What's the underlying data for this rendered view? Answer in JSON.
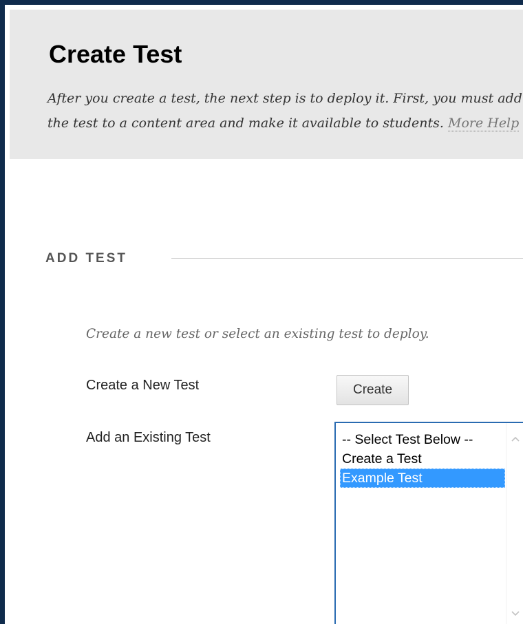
{
  "header": {
    "title": "Create Test",
    "description": "After you create a test, the next step is to deploy it. First, you must add the test to a content area and make it available to students.",
    "more_help_label": "More Help"
  },
  "section": {
    "heading": "ADD TEST",
    "instructions": "Create a new test or select an existing test to deploy."
  },
  "create_row": {
    "label": "Create a New Test",
    "button_label": "Create"
  },
  "existing_row": {
    "label": "Add an Existing Test",
    "options": [
      "-- Select Test Below --",
      "Create a Test",
      "Example Test"
    ],
    "selected_option": "Example Test"
  },
  "icons": {
    "scroll_up": "chevron-up-icon",
    "scroll_down": "chevron-down-icon"
  },
  "colors": {
    "frame_border": "#0f2b4c",
    "header_background": "#e8e8e8",
    "select_border": "#2a6bb1",
    "selection_highlight": "#3399ff"
  }
}
